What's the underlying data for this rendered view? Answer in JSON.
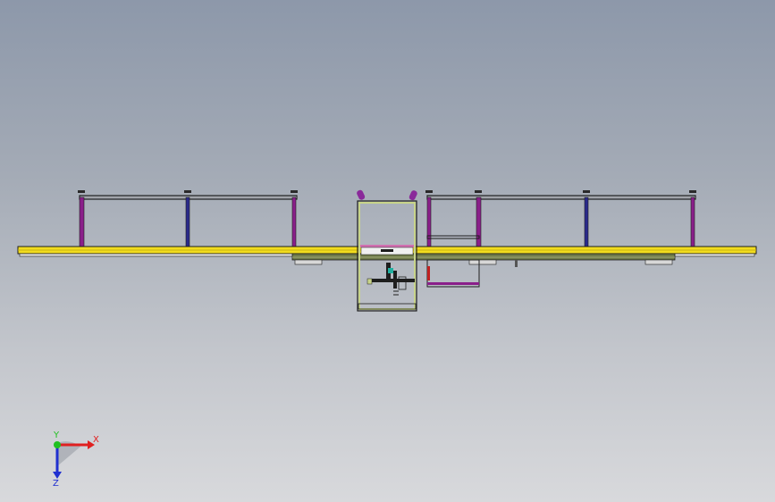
{
  "viewport": {
    "background_top": "#8d98aa",
    "background_bottom": "#d8d9dc"
  },
  "model": {
    "rail_color": "#f2dc1e",
    "frame_color": "#1e1e1e",
    "fence_post_color": "#8a1f8a",
    "fence_post_alt_color": "#2a2a8a",
    "cabinet_color": "#c8d48a",
    "base_color": "#6f7a4a",
    "lifter_color": "#8a2a9a"
  },
  "triad": {
    "x_label": "X",
    "y_label": "Y",
    "z_label": "Z",
    "x_color": "#e02020",
    "y_color": "#20c020",
    "z_color": "#2030d0"
  }
}
